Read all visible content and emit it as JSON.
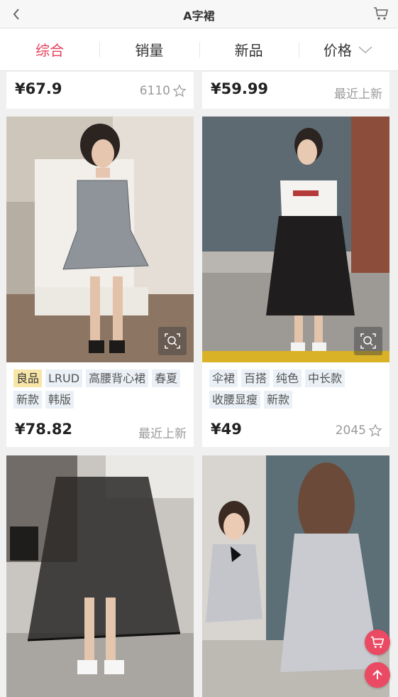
{
  "header": {
    "title": "A字裙",
    "back_icon": "chevron-left-icon",
    "cart_icon": "shopping-cart-icon"
  },
  "sort_tabs": [
    {
      "label": "综合",
      "active": true
    },
    {
      "label": "销量",
      "active": false
    },
    {
      "label": "新品",
      "active": false
    },
    {
      "label": "价格",
      "active": false,
      "icon": "chevron-down-icon"
    }
  ],
  "products": [
    {
      "price": "¥67.9",
      "meta": "6110",
      "meta_icon": "star-icon"
    },
    {
      "price": "¥59.99",
      "meta": "最近上新"
    },
    {
      "tags": [
        "良品",
        "LRUD",
        "高腰背心裙",
        "春夏",
        "新款",
        "韩版"
      ],
      "highlight_tag": "良品",
      "price": "¥78.82",
      "meta": "最近上新",
      "zoom_icon": "zoom-search-icon"
    },
    {
      "tags": [
        "伞裙",
        "百搭",
        "纯色",
        "中长款",
        "收腰显瘦",
        "新款"
      ],
      "price": "¥49",
      "meta": "2045",
      "meta_icon": "star-icon",
      "zoom_icon": "zoom-search-icon"
    },
    {
      "image": "black-tulle-skirt"
    },
    {
      "image": "grey-bow-dress"
    }
  ],
  "floating": {
    "cart_icon": "cart-float-icon",
    "top_icon": "arrow-up-icon"
  },
  "colors": {
    "accent": "#e6405c",
    "tag_bg": "#eaf0f6",
    "tag_highlight_bg": "#f8e6a8",
    "float_btn": "#ea4a63"
  }
}
